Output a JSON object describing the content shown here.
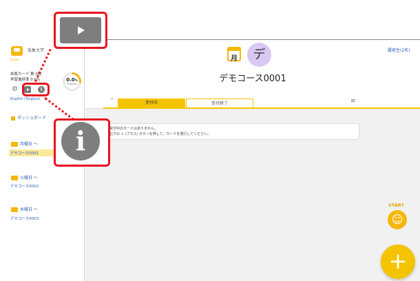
{
  "sidebar": {
    "app_name": "気象大学",
    "logo_sub": "Englen",
    "stats": [
      "未既カード 数 0枚",
      "学習進捗率 0.0%"
    ],
    "progress": {
      "value_label": "0.0",
      "unit": "%",
      "caption": "Progress",
      "fraction": 0.0
    },
    "language": "English / Englisch",
    "dashboard_label": "ダッシュボード",
    "days": [
      {
        "label": "月曜日 〜",
        "course": "デモコース0001",
        "active": true
      },
      {
        "label": "火曜日 〜",
        "course": "デモコース0002",
        "active": false
      },
      {
        "label": "水曜日 〜",
        "course": "デモコース0003",
        "active": false
      }
    ]
  },
  "header": {
    "day_badge": "月",
    "course_badge": "デ",
    "course_title": "デモコース0001",
    "user_name": "履修生(2名)"
  },
  "tabs": [
    {
      "label": "受付中",
      "active": true
    },
    {
      "label": "受付終了",
      "active": false
    }
  ],
  "notice": {
    "line1": "受付中のカードはありません。",
    "line2": "右下の + (プラス) ボタンを押して、カードを発行してください。"
  },
  "fab": {
    "start_label": "START",
    "start_icon": "☺",
    "add_icon": "+"
  },
  "icons": {
    "gear": "⚙",
    "info": "i",
    "chevron_up": "^",
    "menu": "≡"
  },
  "colors": {
    "accent": "#f5c400",
    "callout": "#e8131f",
    "link": "#2d5fb5"
  }
}
